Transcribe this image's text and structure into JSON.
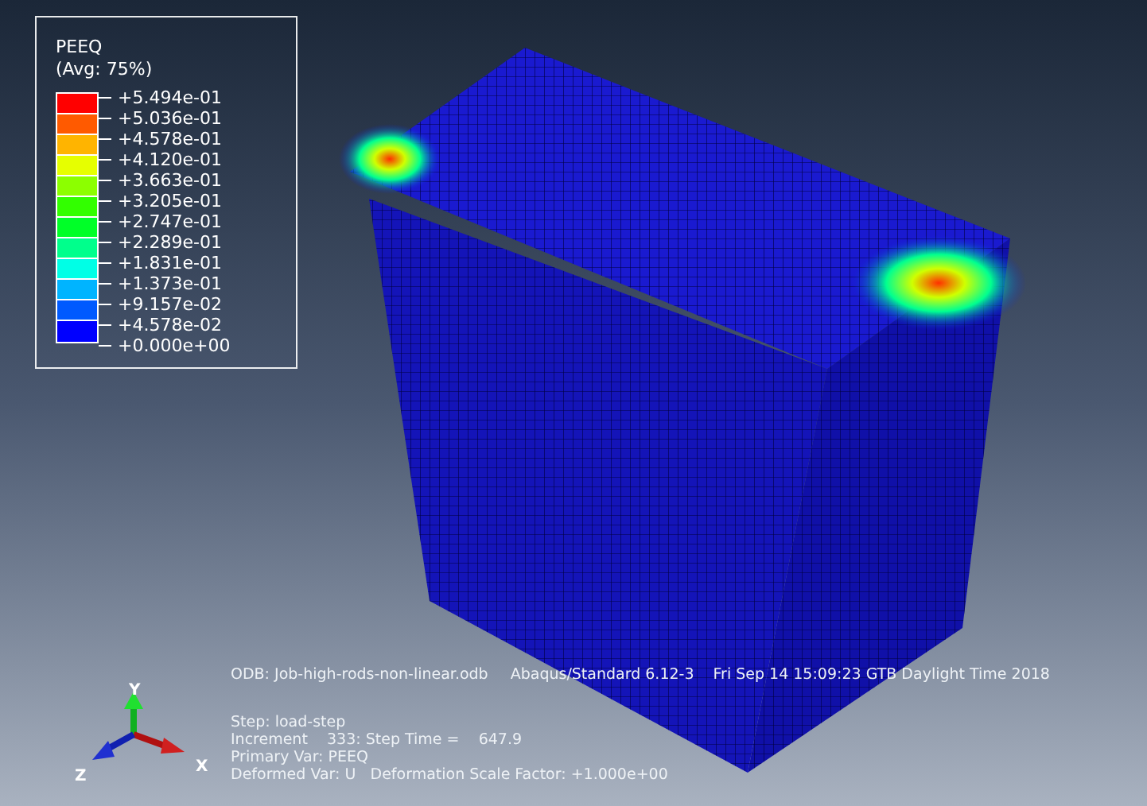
{
  "legend": {
    "title": "PEEQ",
    "subtitle": "(Avg: 75%)",
    "bands": [
      {
        "color": "#ff0000"
      },
      {
        "color": "#ff5a00"
      },
      {
        "color": "#ffb400"
      },
      {
        "color": "#e6ff00"
      },
      {
        "color": "#8cff00"
      },
      {
        "color": "#32ff00"
      },
      {
        "color": "#00ff28"
      },
      {
        "color": "#00ff8c"
      },
      {
        "color": "#00ffe6"
      },
      {
        "color": "#00b4ff"
      },
      {
        "color": "#005aff"
      },
      {
        "color": "#0000ff"
      }
    ],
    "ticks": [
      "+5.494e-01",
      "+5.036e-01",
      "+4.578e-01",
      "+4.120e-01",
      "+3.663e-01",
      "+3.205e-01",
      "+2.747e-01",
      "+2.289e-01",
      "+1.831e-01",
      "+1.373e-01",
      "+9.157e-02",
      "+4.578e-02",
      "+0.000e+00"
    ]
  },
  "header": {
    "odb": "ODB: Job-high-rods-non-linear.odb",
    "solver": "Abaqus/Standard 6.12-3",
    "date": "Fri Sep 14 15:09:23 GTB Daylight Time 2018"
  },
  "info": [
    "Step: load-step",
    "Increment    333: Step Time =    647.9",
    "Primary Var: PEEQ",
    "Deformed Var: U   Deformation Scale Factor: +1.000e+00"
  ],
  "axes": {
    "y": "Y",
    "x": "X",
    "z": "Z"
  }
}
